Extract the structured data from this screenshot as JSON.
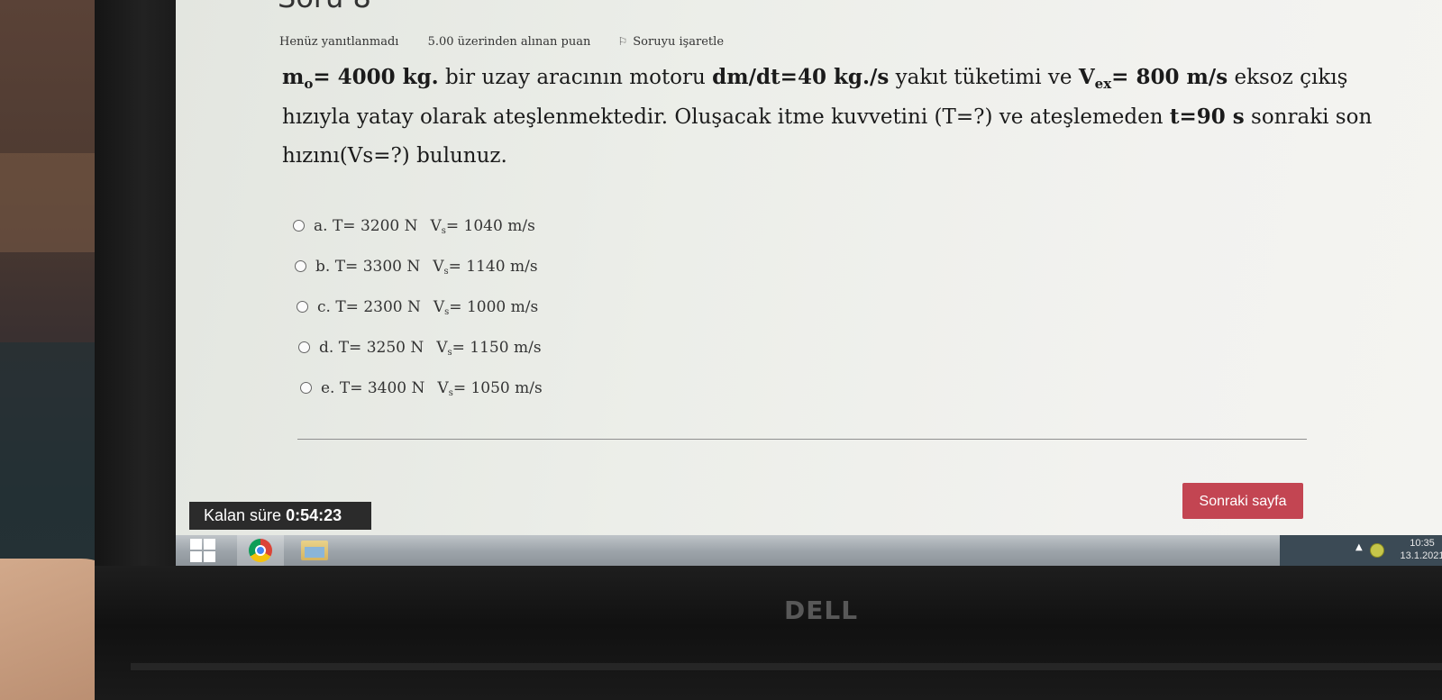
{
  "page": {
    "title": "Soru 8"
  },
  "question_info": {
    "state": "Henüz yanıtlanmadı",
    "mark": "5.00 üzerinden alınan puan",
    "flag_label": "Soruyu işaretle"
  },
  "question": {
    "m0_label": "m",
    "m0_sub": "o",
    "m0_value": "= 4000 kg.",
    "text1": " bir uzay aracının motoru ",
    "rate": "dm/dt=40 kg./s",
    "text2": " yakıt tüketimi ve ",
    "vex_label": "V",
    "vex_sub": "ex",
    "vex_value": "= 800 m/s",
    "text3": " eksoz çıkış hızıyla yatay olarak ateşlenmektedir. Oluşacak itme kuvvetini (T=?) ve ateşlemeden ",
    "time": "t=90 s",
    "text4": " sonraki son hızını(Vs=?) bulunuz."
  },
  "options": [
    {
      "letter": "a.",
      "thrust": "T= 3200 N",
      "v_label": "V",
      "v_sub": "s",
      "v_value": "= 1040 m/s"
    },
    {
      "letter": "b.",
      "thrust": "T= 3300 N",
      "v_label": "V",
      "v_sub": "s",
      "v_value": "= 1140 m/s"
    },
    {
      "letter": "c.",
      "thrust": "T= 2300 N",
      "v_label": "V",
      "v_sub": "s",
      "v_value": "= 1000 m/s"
    },
    {
      "letter": "d.",
      "thrust": "T= 3250 N",
      "v_label": "V",
      "v_sub": "s",
      "v_value": "= 1150 m/s"
    },
    {
      "letter": "e.",
      "thrust": "T= 3400 N",
      "v_label": "V",
      "v_sub": "s",
      "v_value": "= 1050 m/s"
    }
  ],
  "navigation": {
    "next_label": "Sonraki sayfa"
  },
  "timer": {
    "label": "Kalan süre",
    "value": "0:54:23"
  },
  "taskbar": {
    "apps": [
      "start-icon",
      "chrome-icon",
      "file-explorer-icon"
    ],
    "clock_time": "10:35",
    "clock_date": "13.1.2021"
  },
  "hardware": {
    "brand": "DELL"
  },
  "colors": {
    "next_button": "#c34552",
    "timer_bg": "#2b2b2b",
    "taskbar": "#9ea5ab"
  }
}
